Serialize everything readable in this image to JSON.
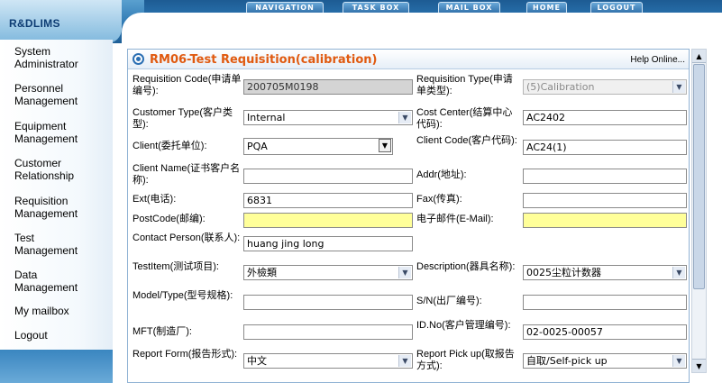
{
  "app": {
    "logo": "R&DLIMS"
  },
  "nav": [
    "NAVIGATION",
    "TASK BOX",
    "MAIL BOX",
    "HOME",
    "LOGOUT"
  ],
  "sidebar": [
    "System\nAdministrator",
    "Personnel\nManagement",
    "Equipment\nManagement",
    "Customer\nRelationship",
    "Requisition\nManagement",
    "Test\nManagement",
    "Data\nManagement",
    "My mailbox",
    "Logout"
  ],
  "panel": {
    "title": "RM06-Test Requisition(calibration)",
    "help": "Help Online..."
  },
  "form": {
    "req_code_label": "Requisition Code(申请单编号):",
    "req_code": "200705M0198",
    "req_type_label": "Requisition Type(申请单类型):",
    "req_type": "(5)Calibration",
    "cust_type_label": "Customer Type(客户类型):",
    "cust_type": "Internal",
    "cost_center_label": "Cost Center(结算中心代码):",
    "cost_center": "AC2402",
    "client_label": "Client(委托单位):",
    "client": "PQA",
    "client_code_label": "Client Code(客户代码):",
    "client_code": "AC24(1)",
    "client_name_label": "Client Name(证书客户名称):",
    "client_name": "",
    "addr_label": "Addr(地址):",
    "addr": "",
    "ext_label": "Ext(电话):",
    "ext": "6831",
    "fax_label": "Fax(传真):",
    "fax": "",
    "postcode_label": "PostCode(邮编):",
    "postcode": "",
    "email_label": "电子邮件(E-Mail):",
    "email": "",
    "contact_label": "Contact Person(联系人):",
    "contact": "huang jing long",
    "testitem_label": "TestItem(测试项目):",
    "testitem": "外檢類",
    "description_label": "Description(器具名称):",
    "description": "0025尘粒计数器",
    "model_label": "Model/Type(型号规格):",
    "model": "",
    "sn_label": "S/N(出厂编号):",
    "sn": "",
    "mft_label": "MFT(制造厂):",
    "mft": "",
    "idno_label": "ID.No(客户管理编号):",
    "idno": "02-0025-00057",
    "report_form_label": "Report Form(报告形式):",
    "report_form": "中文",
    "report_pickup_label": "Report Pick up(取报告方式):",
    "report_pickup": "自取/Self-pick up"
  },
  "icons": {
    "select_arrow": "chevron-down-icon",
    "title": "circle-icon"
  },
  "colors": {
    "title": "#e05a10",
    "highlight": "#ffff99",
    "header": "#2f79b3"
  }
}
